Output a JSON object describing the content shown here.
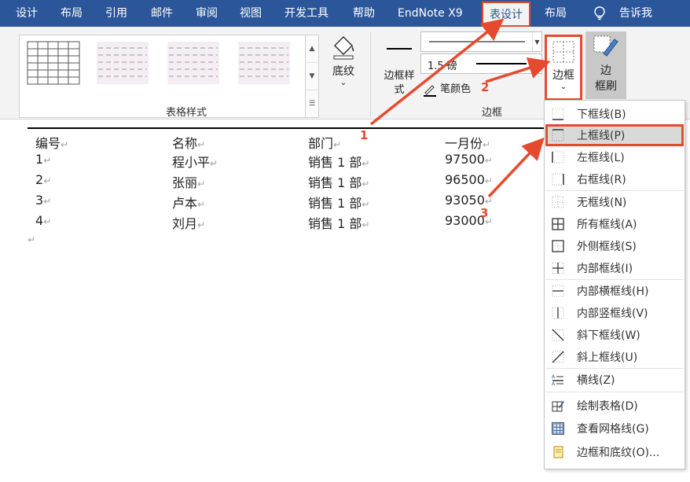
{
  "tabs": [
    "设计",
    "布局",
    "引用",
    "邮件",
    "审阅",
    "视图",
    "开发工具",
    "帮助",
    "EndNote X9",
    "表设计",
    "布局",
    "告诉我"
  ],
  "ribbon": {
    "table_styles_label": "表格样式",
    "shading_label": "底纹",
    "pen_style_label_1": "边框样",
    "pen_style_label_2": "式",
    "pen_weight_value": "1.5 磅",
    "pen_color_label": "笔颜色",
    "borders_group_label": "边框",
    "borders_button_label": "边框",
    "painter_label_1": "边",
    "painter_label_2": "框刷"
  },
  "table": {
    "headers": [
      "编号",
      "名称",
      "部门",
      "一月份"
    ],
    "rows": [
      [
        "1",
        "程小平",
        "销售 1 部",
        "97500"
      ],
      [
        "2",
        "张丽",
        "销售 1 部",
        "96500"
      ],
      [
        "3",
        "卢本",
        "销售 1 部",
        "93050"
      ],
      [
        "4",
        "刘月",
        "销售 1 部",
        "93000"
      ]
    ],
    "mark": "↵"
  },
  "menu": {
    "items": [
      {
        "label": "下框线(B)",
        "icon": "bottom-border-icon"
      },
      {
        "label": "上框线(P)",
        "icon": "top-border-icon",
        "selected": true
      },
      {
        "label": "左框线(L)",
        "icon": "left-border-icon"
      },
      {
        "label": "右框线(R)",
        "icon": "right-border-icon"
      },
      {
        "label": "无框线(N)",
        "icon": "no-border-icon"
      },
      {
        "label": "所有框线(A)",
        "icon": "all-borders-icon"
      },
      {
        "label": "外侧框线(S)",
        "icon": "outside-borders-icon"
      },
      {
        "label": "内部框线(I)",
        "icon": "inside-borders-icon"
      },
      {
        "label": "内部横框线(H)",
        "icon": "inside-horizontal-border-icon"
      },
      {
        "label": "内部竖框线(V)",
        "icon": "inside-vertical-border-icon"
      },
      {
        "label": "斜下框线(W)",
        "icon": "diagonal-down-border-icon"
      },
      {
        "label": "斜上框线(U)",
        "icon": "diagonal-up-border-icon"
      },
      {
        "label": "横线(Z)",
        "icon": "horizontal-line-icon"
      },
      {
        "label": "绘制表格(D)",
        "icon": "draw-table-icon"
      },
      {
        "label": "查看网格线(G)",
        "icon": "view-gridlines-icon"
      },
      {
        "label": "边框和底纹(O)...",
        "icon": "borders-shading-icon"
      }
    ]
  },
  "callouts": [
    "1",
    "2",
    "3"
  ],
  "colors": {
    "ribbon_blue": "#2b579a",
    "highlight_red": "#e64a2e"
  }
}
